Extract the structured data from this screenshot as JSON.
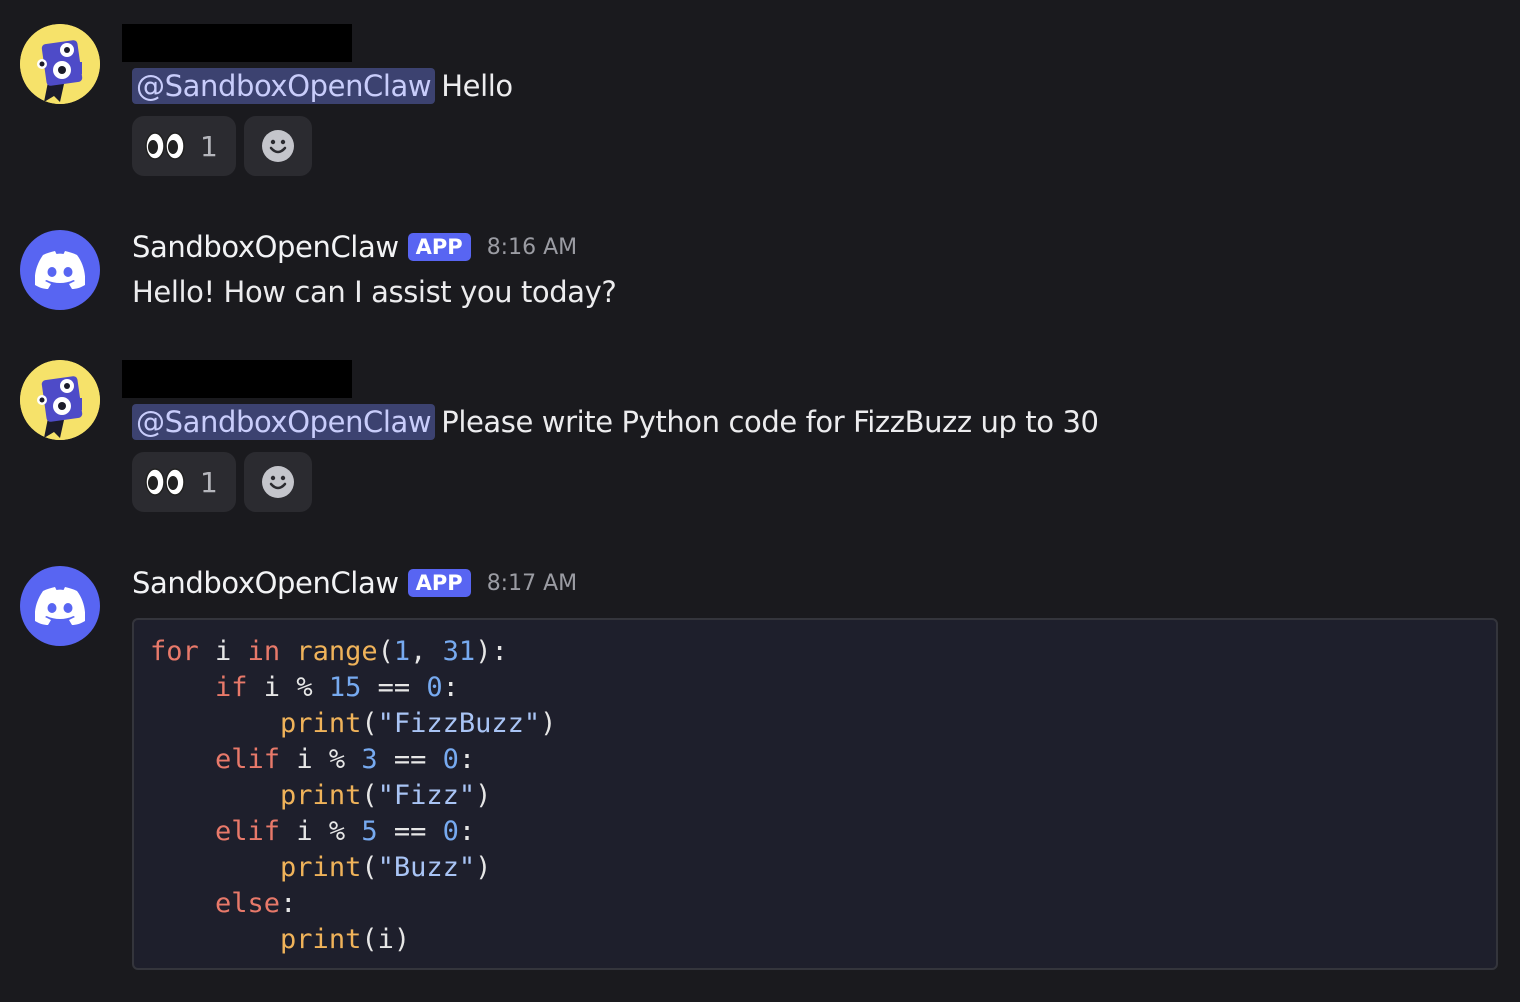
{
  "messages": [
    {
      "mention": "@SandboxOpenClaw",
      "text": "Hello",
      "reaction_emoji": "eyes-emoji",
      "reaction_count": "1"
    },
    {
      "username": "SandboxOpenClaw",
      "tag": "APP",
      "time": "8:16 AM",
      "text": "Hello! How can I assist you today?"
    },
    {
      "mention": "@SandboxOpenClaw",
      "text": "Please write Python code for FizzBuzz up to 30",
      "reaction_emoji": "eyes-emoji",
      "reaction_count": "1"
    },
    {
      "username": "SandboxOpenClaw",
      "tag": "APP",
      "time": "8:17 AM",
      "code": [
        [
          [
            "kw",
            "for"
          ],
          [
            "op",
            " i "
          ],
          [
            "kw",
            "in"
          ],
          [
            "op",
            " "
          ],
          [
            "fn",
            "range"
          ],
          [
            "op",
            "("
          ],
          [
            "num",
            "1"
          ],
          [
            "op",
            ", "
          ],
          [
            "num",
            "31"
          ],
          [
            "op",
            "):"
          ]
        ],
        [
          [
            "op",
            "    "
          ],
          [
            "kw",
            "if"
          ],
          [
            "op",
            " i % "
          ],
          [
            "num",
            "15"
          ],
          [
            "op",
            " == "
          ],
          [
            "num",
            "0"
          ],
          [
            "op",
            ":"
          ]
        ],
        [
          [
            "op",
            "        "
          ],
          [
            "fn",
            "print"
          ],
          [
            "op",
            "("
          ],
          [
            "str",
            "\"FizzBuzz\""
          ],
          [
            "op",
            ")"
          ]
        ],
        [
          [
            "op",
            "    "
          ],
          [
            "kw",
            "elif"
          ],
          [
            "op",
            " i % "
          ],
          [
            "num",
            "3"
          ],
          [
            "op",
            " == "
          ],
          [
            "num",
            "0"
          ],
          [
            "op",
            ":"
          ]
        ],
        [
          [
            "op",
            "        "
          ],
          [
            "fn",
            "print"
          ],
          [
            "op",
            "("
          ],
          [
            "str",
            "\"Fizz\""
          ],
          [
            "op",
            ")"
          ]
        ],
        [
          [
            "op",
            "    "
          ],
          [
            "kw",
            "elif"
          ],
          [
            "op",
            " i % "
          ],
          [
            "num",
            "5"
          ],
          [
            "op",
            " == "
          ],
          [
            "num",
            "0"
          ],
          [
            "op",
            ":"
          ]
        ],
        [
          [
            "op",
            "        "
          ],
          [
            "fn",
            "print"
          ],
          [
            "op",
            "("
          ],
          [
            "str",
            "\"Buzz\""
          ],
          [
            "op",
            ")"
          ]
        ],
        [
          [
            "op",
            "    "
          ],
          [
            "kw",
            "else"
          ],
          [
            "op",
            ":"
          ]
        ],
        [
          [
            "op",
            "        "
          ],
          [
            "fn",
            "print"
          ],
          [
            "op",
            "(i)"
          ]
        ]
      ]
    }
  ],
  "colors": {
    "background": "#1a1a1e",
    "mention_bg": "#3c4270",
    "app_tag": "#5865f2",
    "bot_avatar": "#5865f2",
    "user_avatar": "#f6e26a"
  }
}
